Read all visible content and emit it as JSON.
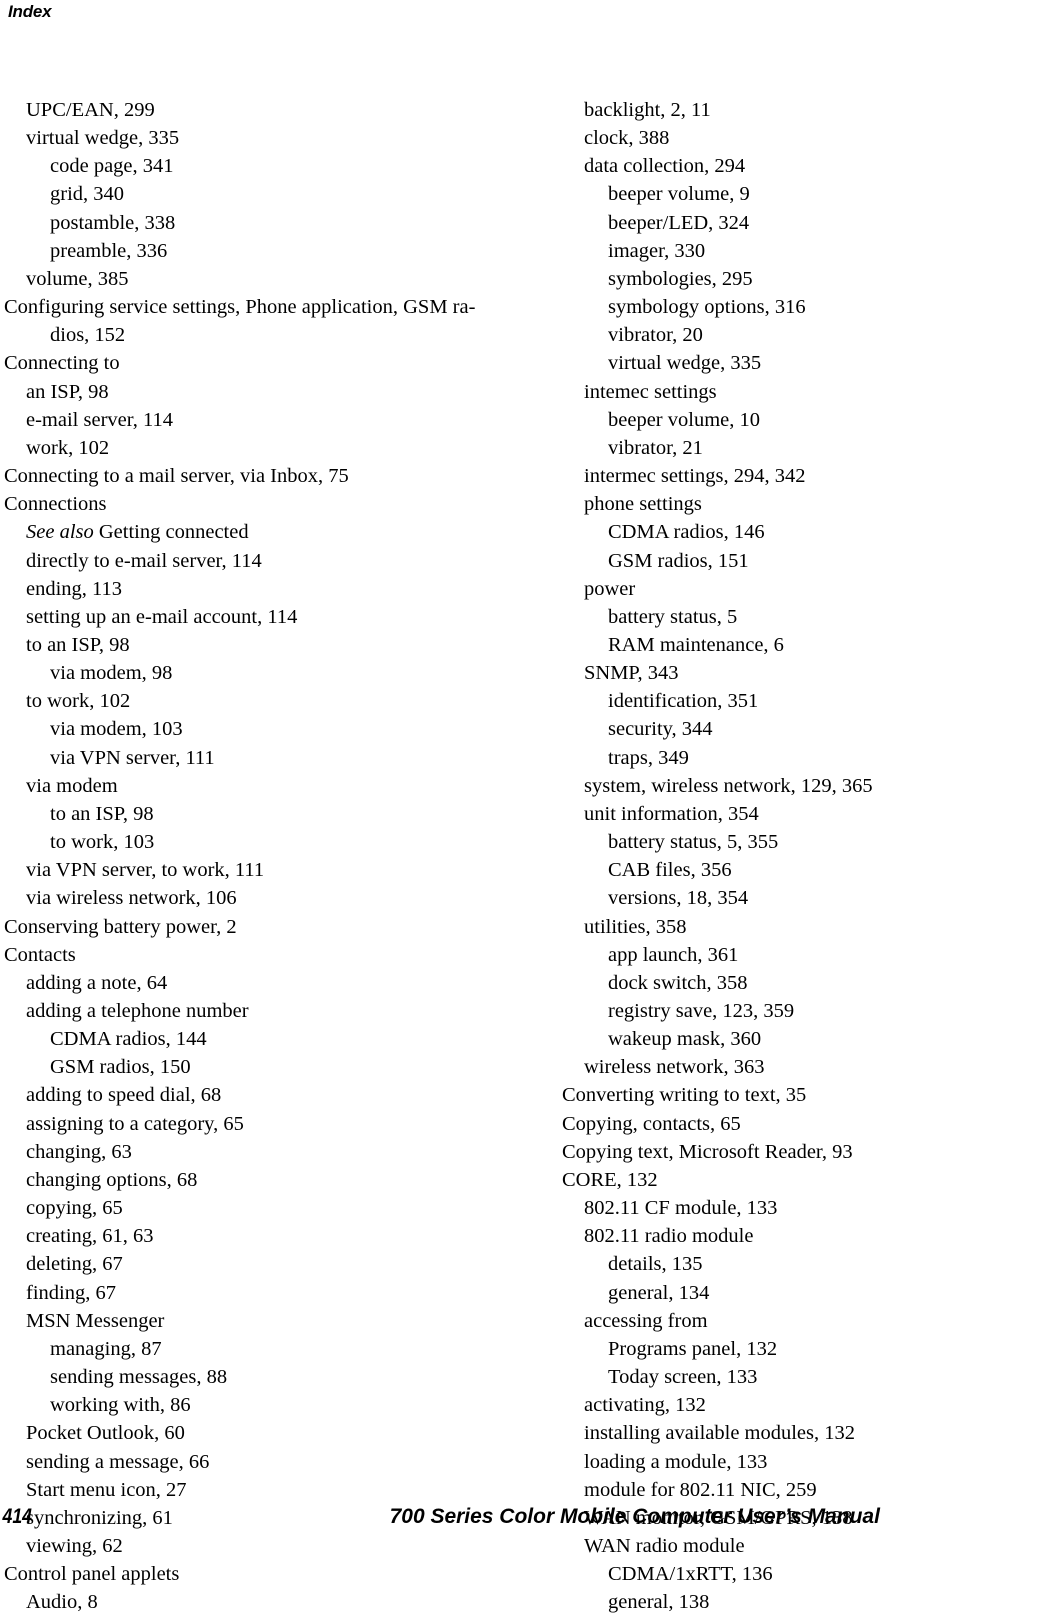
{
  "header": {
    "running_head": "Index"
  },
  "footer": {
    "page_number": "414",
    "manual_title": "700 Series Color Mobile Computer User’s Manual"
  },
  "index": {
    "left_column": [
      {
        "level": 1,
        "text": "UPC/EAN, 299"
      },
      {
        "level": 1,
        "text": "virtual wedge, 335"
      },
      {
        "level": 2,
        "text": "code page, 341"
      },
      {
        "level": 2,
        "text": "grid, 340"
      },
      {
        "level": 2,
        "text": "postamble, 338"
      },
      {
        "level": 2,
        "text": "preamble, 336"
      },
      {
        "level": 1,
        "text": "volume, 385"
      },
      {
        "level": 0,
        "text": "Configuring service settings, Phone application, GSM ra-",
        "wrap": "dios, 152"
      },
      {
        "level": 0,
        "text": "Connecting to"
      },
      {
        "level": 1,
        "text": "an ISP, 98"
      },
      {
        "level": 1,
        "text": "e-mail server, 114"
      },
      {
        "level": 1,
        "text": "work, 102"
      },
      {
        "level": 0,
        "text": "Connecting to a mail server, via Inbox, 75"
      },
      {
        "level": 0,
        "text": "Connections"
      },
      {
        "level": 1,
        "italic_prefix": "See also",
        "text": " Getting connected"
      },
      {
        "level": 1,
        "text": "directly to e-mail server, 114"
      },
      {
        "level": 1,
        "text": "ending, 113"
      },
      {
        "level": 1,
        "text": "setting up an e-mail account, 114"
      },
      {
        "level": 1,
        "text": "to an ISP, 98"
      },
      {
        "level": 2,
        "text": "via modem, 98"
      },
      {
        "level": 1,
        "text": "to work, 102"
      },
      {
        "level": 2,
        "text": "via modem, 103"
      },
      {
        "level": 2,
        "text": "via VPN server, 111"
      },
      {
        "level": 1,
        "text": "via modem"
      },
      {
        "level": 2,
        "text": "to an ISP, 98"
      },
      {
        "level": 2,
        "text": "to work, 103"
      },
      {
        "level": 1,
        "text": "via VPN server, to work, 111"
      },
      {
        "level": 1,
        "text": "via wireless network, 106"
      },
      {
        "level": 0,
        "text": "Conserving battery power, 2"
      },
      {
        "level": 0,
        "text": "Contacts"
      },
      {
        "level": 1,
        "text": "adding a note, 64"
      },
      {
        "level": 1,
        "text": "adding a telephone number"
      },
      {
        "level": 2,
        "text": "CDMA radios, 144"
      },
      {
        "level": 2,
        "text": "GSM radios, 150"
      },
      {
        "level": 1,
        "text": "adding to speed dial, 68"
      },
      {
        "level": 1,
        "text": "assigning to a category, 65"
      },
      {
        "level": 1,
        "text": "changing, 63"
      },
      {
        "level": 1,
        "text": "changing options, 68"
      },
      {
        "level": 1,
        "text": "copying, 65"
      },
      {
        "level": 1,
        "text": "creating, 61, 63"
      },
      {
        "level": 1,
        "text": "deleting, 67"
      },
      {
        "level": 1,
        "text": "finding, 67"
      },
      {
        "level": 1,
        "text": "MSN Messenger"
      },
      {
        "level": 2,
        "text": "managing, 87"
      },
      {
        "level": 2,
        "text": "sending messages, 88"
      },
      {
        "level": 2,
        "text": "working with, 86"
      },
      {
        "level": 1,
        "text": "Pocket Outlook, 60"
      },
      {
        "level": 1,
        "text": "sending a message, 66"
      },
      {
        "level": 1,
        "text": "Start menu icon, 27"
      },
      {
        "level": 1,
        "text": "synchronizing, 61"
      },
      {
        "level": 1,
        "text": "viewing, 62"
      },
      {
        "level": 0,
        "text": "Control panel applets"
      },
      {
        "level": 1,
        "text": "Audio, 8"
      }
    ],
    "right_column": [
      {
        "level": 1,
        "text": "backlight, 2, 11"
      },
      {
        "level": 1,
        "text": "clock, 388"
      },
      {
        "level": 1,
        "text": "data collection, 294"
      },
      {
        "level": 2,
        "text": "beeper volume, 9"
      },
      {
        "level": 2,
        "text": "beeper/LED, 324"
      },
      {
        "level": 2,
        "text": "imager, 330"
      },
      {
        "level": 2,
        "text": "symbologies, 295"
      },
      {
        "level": 2,
        "text": "symbology options, 316"
      },
      {
        "level": 2,
        "text": "vibrator, 20"
      },
      {
        "level": 2,
        "text": "virtual wedge, 335"
      },
      {
        "level": 1,
        "text": "intemec settings"
      },
      {
        "level": 2,
        "text": "beeper volume, 10"
      },
      {
        "level": 2,
        "text": "vibrator, 21"
      },
      {
        "level": 1,
        "text": "intermec settings, 294, 342"
      },
      {
        "level": 1,
        "text": "phone settings"
      },
      {
        "level": 2,
        "text": "CDMA radios, 146"
      },
      {
        "level": 2,
        "text": "GSM radios, 151"
      },
      {
        "level": 1,
        "text": "power"
      },
      {
        "level": 2,
        "text": "battery status, 5"
      },
      {
        "level": 2,
        "text": "RAM maintenance, 6"
      },
      {
        "level": 1,
        "text": "SNMP, 343"
      },
      {
        "level": 2,
        "text": "identification, 351"
      },
      {
        "level": 2,
        "text": "security, 344"
      },
      {
        "level": 2,
        "text": "traps, 349"
      },
      {
        "level": 1,
        "text": "system, wireless network, 129, 365"
      },
      {
        "level": 1,
        "text": "unit information, 354"
      },
      {
        "level": 2,
        "text": "battery status, 5, 355"
      },
      {
        "level": 2,
        "text": "CAB files, 356"
      },
      {
        "level": 2,
        "text": "versions, 18, 354"
      },
      {
        "level": 1,
        "text": "utilities, 358"
      },
      {
        "level": 2,
        "text": "app launch, 361"
      },
      {
        "level": 2,
        "text": "dock switch, 358"
      },
      {
        "level": 2,
        "text": "registry save, 123, 359"
      },
      {
        "level": 2,
        "text": "wakeup mask, 360"
      },
      {
        "level": 1,
        "text": "wireless network, 363"
      },
      {
        "level": 0,
        "text": "Converting writing to text, 35"
      },
      {
        "level": 0,
        "text": "Copying, contacts, 65"
      },
      {
        "level": 0,
        "text": "Copying text, Microsoft Reader, 93"
      },
      {
        "level": 0,
        "text": "CORE, 132"
      },
      {
        "level": 1,
        "text": "802.11 CF module, 133"
      },
      {
        "level": 1,
        "text": "802.11 radio module"
      },
      {
        "level": 2,
        "text": "details, 135"
      },
      {
        "level": 2,
        "text": "general, 134"
      },
      {
        "level": 1,
        "text": "accessing from"
      },
      {
        "level": 2,
        "text": "Programs panel, 132"
      },
      {
        "level": 2,
        "text": "Today screen, 133"
      },
      {
        "level": 1,
        "text": "activating, 132"
      },
      {
        "level": 1,
        "text": "installing available modules, 132"
      },
      {
        "level": 1,
        "text": "loading a module, 133"
      },
      {
        "level": 1,
        "text": "module for 802.11 NIC, 259"
      },
      {
        "level": 1,
        "text": "WAN monitor, GSM/GPRS, 138"
      },
      {
        "level": 1,
        "text": "WAN radio module"
      },
      {
        "level": 2,
        "text": "CDMA/1xRTT, 136"
      },
      {
        "level": 2,
        "text": "general, 138"
      }
    ]
  }
}
